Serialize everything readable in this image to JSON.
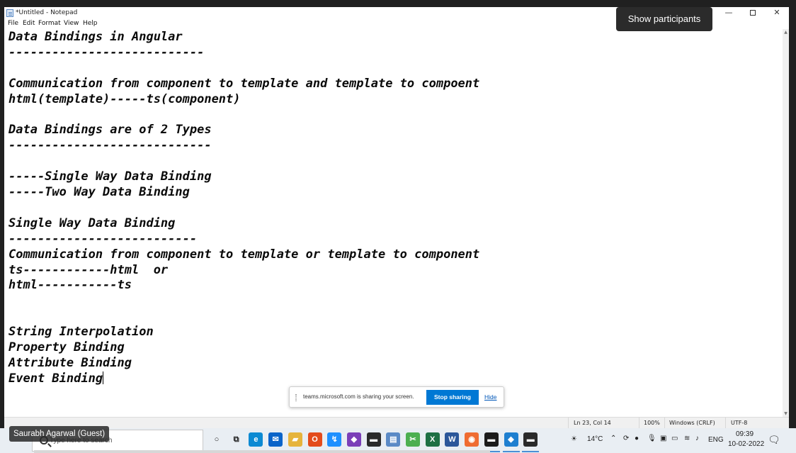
{
  "window": {
    "title": "*Untitled - Notepad",
    "minimize_glyph": "—",
    "close_glyph": "✕"
  },
  "menu": [
    "File",
    "Edit",
    "Format",
    "View",
    "Help"
  ],
  "editor_lines": [
    "Data Bindings in Angular",
    "---------------------------",
    "",
    "Communication from component to template and template to compoent",
    "html(template)-----ts(component)",
    "",
    "Data Bindings are of 2 Types",
    "----------------------------",
    "",
    "-----Single Way Data Binding",
    "-----Two Way Data Binding",
    "",
    "Single Way Data Binding",
    "--------------------------",
    "Communication from component to template or template to component",
    "ts------------html  or",
    "html-----------ts",
    "",
    "",
    "String Interpolation",
    "Property Binding",
    "Attribute Binding",
    "Event Binding"
  ],
  "status": {
    "position": "Ln 23, Col 14",
    "zoom": "100%",
    "line_endings": "Windows (CRLF)",
    "encoding": "UTF-8"
  },
  "tooltip": "Show participants",
  "share_bar": {
    "message": "teams.microsoft.com is sharing your screen.",
    "stop_label": "Stop sharing",
    "hide_label": "Hide"
  },
  "taskbar": {
    "search_placeholder": "Type here to search",
    "apps": [
      {
        "icon": "cortana-icon",
        "color": "#222222"
      },
      {
        "icon": "task-view-icon",
        "color": "#222222"
      },
      {
        "icon": "edge-icon",
        "color": "#0c8ad3"
      },
      {
        "icon": "mail-icon",
        "color": "#0a64c9"
      },
      {
        "icon": "file-explorer-icon",
        "color": "#e6b43c"
      },
      {
        "icon": "office-icon",
        "color": "#e34b1c"
      },
      {
        "icon": "messenger-icon",
        "color": "#1e90ff"
      },
      {
        "icon": "visual-studio-icon",
        "color": "#7b3fb8"
      },
      {
        "icon": "terminal-icon",
        "color": "#2a2a2a"
      },
      {
        "icon": "notepad-icon",
        "color": "#5a8ac6"
      },
      {
        "icon": "snip-tool-icon",
        "color": "#4caf50"
      },
      {
        "icon": "excel-icon",
        "color": "#1d7044"
      },
      {
        "icon": "word-icon",
        "color": "#2b579a"
      },
      {
        "icon": "postman-icon",
        "color": "#ef6c32"
      },
      {
        "icon": "cmd-icon",
        "color": "#1b1b1b"
      },
      {
        "icon": "vscode-icon",
        "color": "#1e7fd0"
      },
      {
        "icon": "console-icon",
        "color": "#2a2a2a"
      }
    ],
    "weather": "14°C",
    "language": "ENG",
    "time": "09:39",
    "date": "10-02-2022"
  },
  "guest_label": "Saurabh Agarwal (Guest)"
}
